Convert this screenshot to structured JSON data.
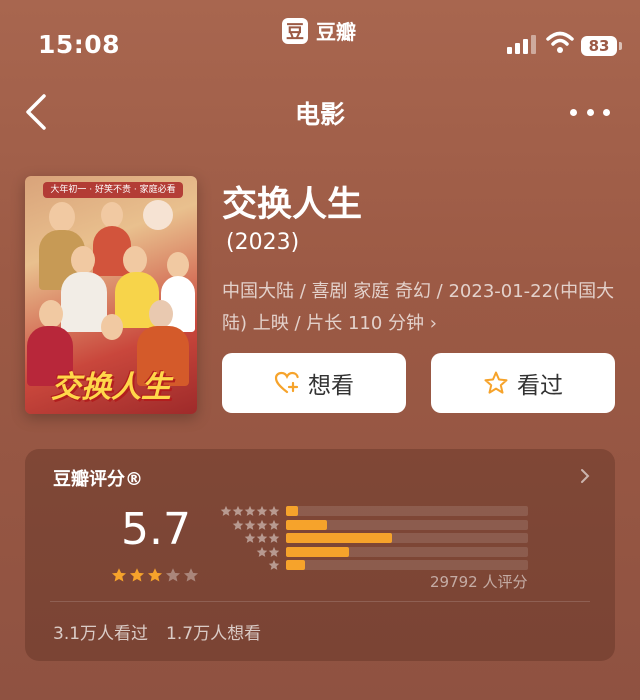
{
  "status_bar": {
    "time": "15:08",
    "app_logo": "豆",
    "app_name": "豆瓣",
    "battery": "83"
  },
  "nav": {
    "title": "电影",
    "back_icon": "chevron-left-icon",
    "more_icon": "ellipsis-icon"
  },
  "poster": {
    "banner_text": "大年初一 · 好笑不贵 · 家庭必看",
    "title_text": "交换人生"
  },
  "movie": {
    "title": "交换人生",
    "year": "(2023)",
    "meta_line": "中国大陆 / 喜剧 家庭 奇幻 / 2023-01-22(中国大陆) 上映 / 片长 110 分钟",
    "meta_arrow": "›"
  },
  "actions": {
    "want_label": "想看",
    "seen_label": "看过"
  },
  "rating": {
    "title": "豆瓣评分®",
    "score": "5.7",
    "stars_filled": 3,
    "stars_total": 5,
    "distribution": [
      {
        "stars": 5,
        "fraction": 0.05
      },
      {
        "stars": 4,
        "fraction": 0.17
      },
      {
        "stars": 3,
        "fraction": 0.44
      },
      {
        "stars": 2,
        "fraction": 0.26
      },
      {
        "stars": 1,
        "fraction": 0.08
      }
    ],
    "count_text": "29792 人评分",
    "seen_text": "3.1万人看过",
    "want_text": "1.7万人想看"
  },
  "colors": {
    "background": "#9c5a45",
    "star": "#f6a32b",
    "bar": "#f6a32b"
  }
}
